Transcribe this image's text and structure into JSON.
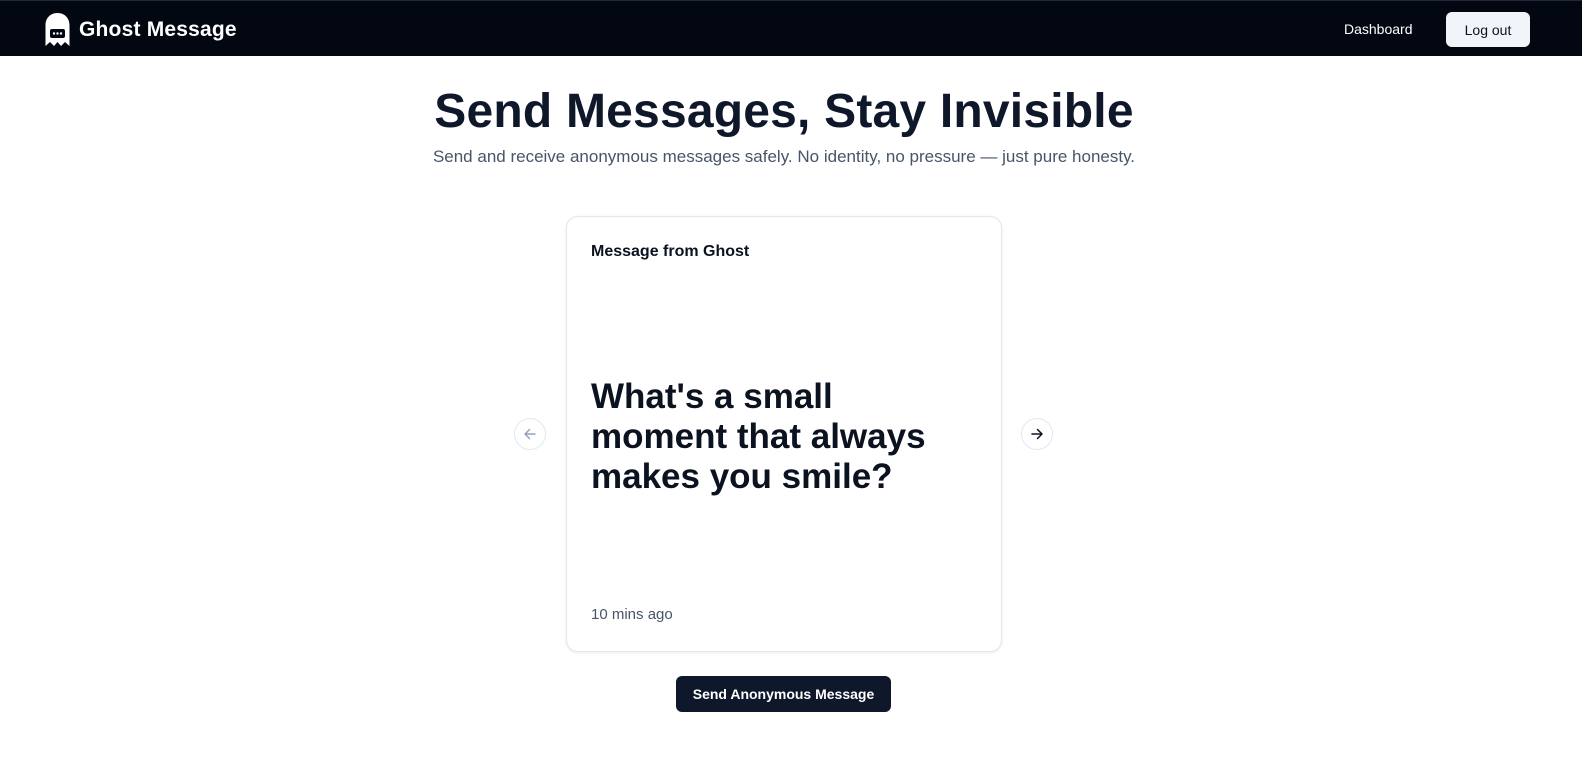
{
  "navbar": {
    "brand_name": "Ghost Message",
    "brand_icon": "ghost-chat-icon",
    "dashboard_label": "Dashboard",
    "logout_label": "Log out",
    "background": "#030712"
  },
  "hero": {
    "title": "Send Messages, Stay Invisible",
    "subtitle": "Send and receive anonymous messages safely. No identity, no pressure — just pure honesty."
  },
  "carousel": {
    "prev_icon": "arrow-left-icon",
    "next_icon": "arrow-right-icon",
    "card": {
      "header": "Message from Ghost",
      "content": "What's a small moment that always makes you smile?",
      "time": "10 mins ago"
    }
  },
  "cta": {
    "send_label": "Send Anonymous Message",
    "background": "#0f172a"
  }
}
